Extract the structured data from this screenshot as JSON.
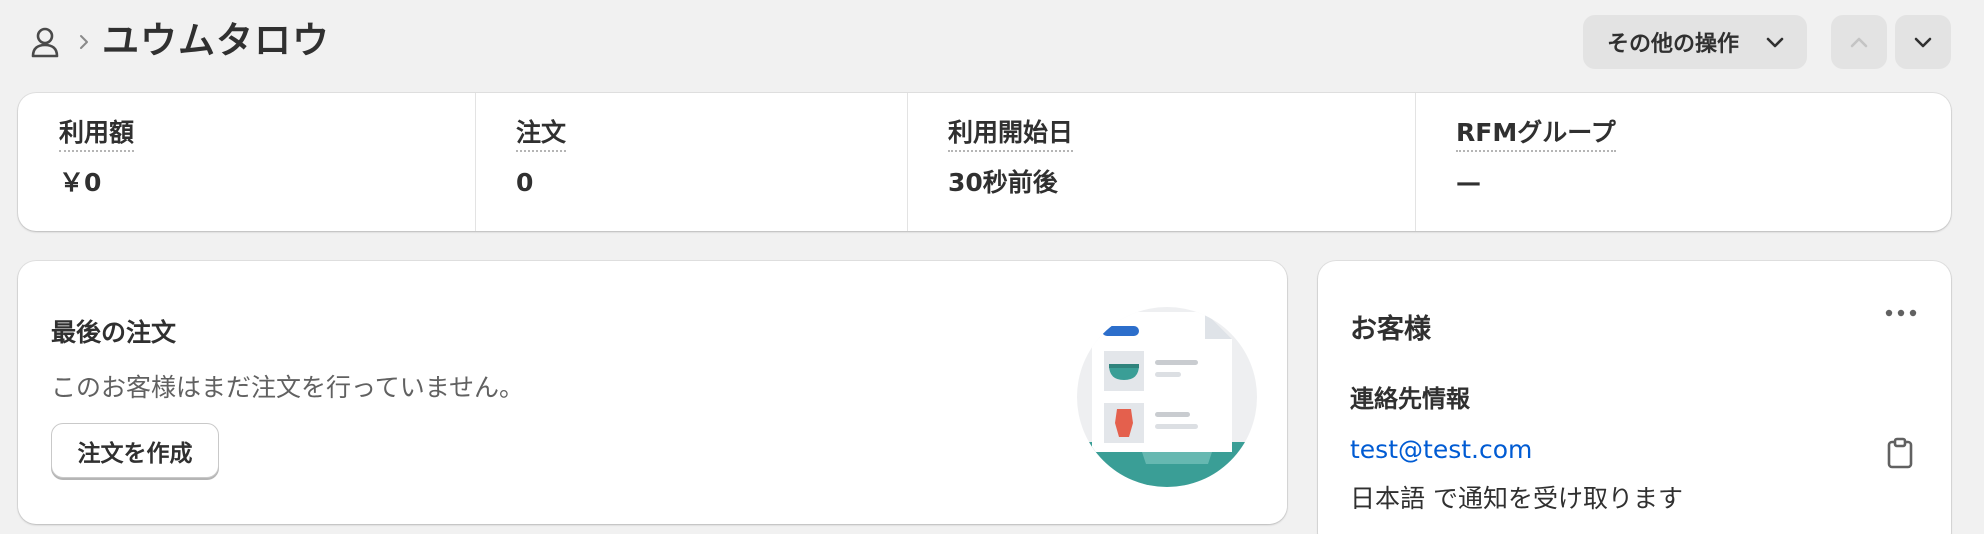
{
  "header": {
    "title": "ユウムタロウ",
    "more_actions_label": "その他の操作",
    "icons": {
      "person": "person-icon",
      "breadcrumb": "chevron-right-icon",
      "dropdown": "chevron-down-icon",
      "prev": "chevron-up-icon",
      "next": "chevron-down-icon"
    }
  },
  "metrics": [
    {
      "label": "利用額",
      "value": "￥0"
    },
    {
      "label": "注文",
      "value": "0"
    },
    {
      "label": "利用開始日",
      "value": "30秒前後"
    },
    {
      "label": "RFMグループ",
      "value": "—"
    }
  ],
  "last_order": {
    "title": "最後の注文",
    "description": "このお客様はまだ注文を行っていません。",
    "create_button": "注文を作成"
  },
  "customer": {
    "title": "お客様",
    "contact_heading": "連絡先情報",
    "email": "test@test.com",
    "notification_language": "日本語 で通知を受け取ります",
    "icons": {
      "menu": "ellipsis-icon",
      "copy": "clipboard-icon"
    }
  },
  "colors": {
    "background": "#f1f1f1",
    "card": "#ffffff",
    "link": "#005bd3",
    "button_secondary": "#e3e3e3",
    "illustration_teal": "#3a9e96",
    "illustration_red": "#e4604d",
    "illustration_blue": "#2c6ecb"
  }
}
